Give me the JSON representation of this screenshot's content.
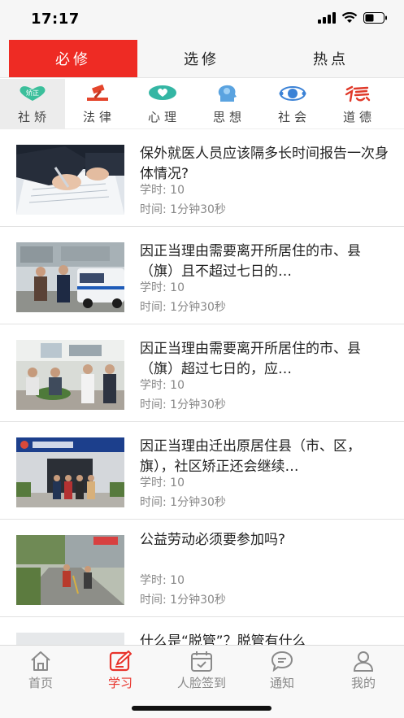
{
  "status": {
    "time": "17:17"
  },
  "tabs": [
    {
      "label": "必修",
      "active": true
    },
    {
      "label": "选修",
      "active": false
    },
    {
      "label": "热点",
      "active": false
    }
  ],
  "categories": [
    {
      "label": "社矫",
      "icon": "heart-badge-icon",
      "badge": "矫正",
      "active": true
    },
    {
      "label": "法律",
      "icon": "gavel-icon",
      "active": false
    },
    {
      "label": "心理",
      "icon": "heart-chat-icon",
      "active": false
    },
    {
      "label": "思想",
      "icon": "head-brain-icon",
      "active": false
    },
    {
      "label": "社会",
      "icon": "orbit-icon",
      "active": false
    },
    {
      "label": "道德",
      "icon": "calligraphy-de-icon",
      "active": false
    }
  ],
  "items": [
    {
      "title": "保外就医人员应该隔多长时间报告一次身体情况?",
      "hours": "学时: 10",
      "duration": "时间: 1分钟30秒",
      "thumb": "writing-hand"
    },
    {
      "title": "因正当理由需要离开所居住的市、县（旗）且不超过七日的…",
      "hours": "学时: 10",
      "duration": "时间: 1分钟30秒",
      "thumb": "police-car"
    },
    {
      "title": "因正当理由需要离开所居住的市、县（旗）超过七日的，应…",
      "hours": "学时: 10",
      "duration": "时间: 1分钟30秒",
      "thumb": "office-group"
    },
    {
      "title": "因正当理由迁出原居住县（市、区，旗），社区矫正还会继续…",
      "hours": "学时: 10",
      "duration": "时间: 1分钟30秒",
      "thumb": "justice-office"
    },
    {
      "title": "公益劳动必须要参加吗?",
      "hours": "学时: 10",
      "duration": "时间: 1分钟30秒",
      "thumb": "street-cleaning"
    },
    {
      "title": "什么是“脱管”？脱管有什么",
      "hours": "",
      "duration": "",
      "thumb": "officer"
    }
  ],
  "nav": [
    {
      "label": "首页",
      "icon": "home-icon",
      "active": false
    },
    {
      "label": "学习",
      "icon": "edit-icon",
      "active": true
    },
    {
      "label": "人脸签到",
      "icon": "calendar-check-icon",
      "active": false
    },
    {
      "label": "通知",
      "icon": "chat-bubble-icon",
      "active": false
    },
    {
      "label": "我的",
      "icon": "user-icon",
      "active": false
    }
  ],
  "colors": {
    "accent": "#ee2b24",
    "inactive": "#888888"
  }
}
